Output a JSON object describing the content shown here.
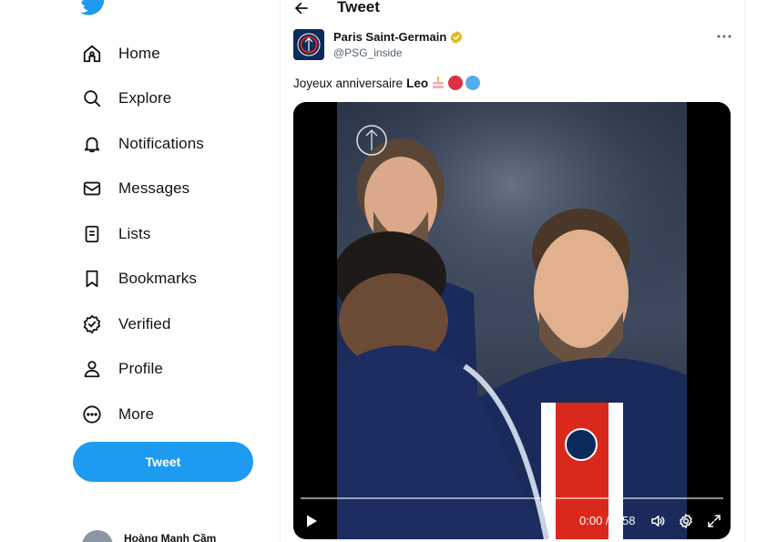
{
  "sidebar": {
    "items": [
      {
        "label": "Home",
        "icon": "home-icon"
      },
      {
        "label": "Explore",
        "icon": "search-icon"
      },
      {
        "label": "Notifications",
        "icon": "bell-icon"
      },
      {
        "label": "Messages",
        "icon": "envelope-icon"
      },
      {
        "label": "Lists",
        "icon": "list-icon"
      },
      {
        "label": "Bookmarks",
        "icon": "bookmark-icon"
      },
      {
        "label": "Verified",
        "icon": "verified-badge-icon"
      },
      {
        "label": "Profile",
        "icon": "person-icon"
      },
      {
        "label": "More",
        "icon": "more-circle-icon"
      }
    ],
    "tweet_button": "Tweet",
    "account_name": "Hoàng Mạnh Cầm"
  },
  "header": {
    "title": "Tweet"
  },
  "tweet": {
    "author_name": "Paris Saint-Germain",
    "author_handle": "@PSG_inside",
    "text_prefix": "Joyeux anniversaire",
    "text_bold": "Leo",
    "emojis": [
      "cake",
      "red-circle",
      "blue-circle"
    ],
    "video": {
      "time": "0:00 / 0:58",
      "progress": 0.0
    }
  },
  "colors": {
    "accent": "#1d9bf0",
    "verified_gold": "#e2b719",
    "psg_navy": "#0b2a5c",
    "psg_red": "#da291c"
  }
}
